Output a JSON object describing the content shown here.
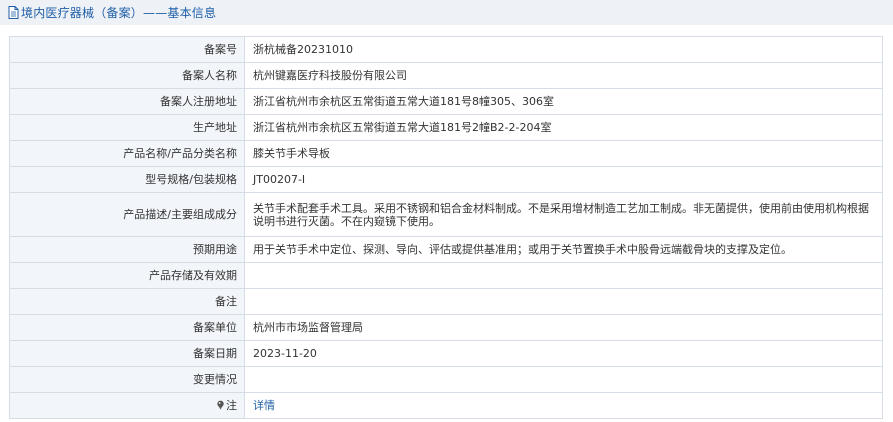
{
  "header": {
    "title": "境内医疗器械（备案）——基本信息",
    "icon": "document-icon"
  },
  "rows": [
    {
      "label": "备案号",
      "value": "浙杭械备20231010"
    },
    {
      "label": "备案人名称",
      "value": "杭州键嘉医疗科技股份有限公司"
    },
    {
      "label": "备案人注册地址",
      "value": "浙江省杭州市余杭区五常街道五常大道181号8幢305、306室"
    },
    {
      "label": "生产地址",
      "value": "浙江省杭州市余杭区五常街道五常大道181号2幢B2-2-204室"
    },
    {
      "label": "产品名称/产品分类名称",
      "value": "膝关节手术导板"
    },
    {
      "label": "型号规格/包装规格",
      "value": "JT00207-I"
    },
    {
      "label": "产品描述/主要组成成分",
      "value": "关节手术配套手术工具。采用不锈钢和铝合金材料制成。不是采用增材制造工艺加工制成。非无菌提供，使用前由使用机构根据说明书进行灭菌。不在内窥镜下使用。"
    },
    {
      "label": "预期用途",
      "value": "用于关节手术中定位、探测、导向、评估或提供基准用；或用于关节置换手术中股骨远端截骨块的支撑及定位。"
    },
    {
      "label": "产品存储及有效期",
      "value": ""
    },
    {
      "label": "备注",
      "value": ""
    },
    {
      "label": "备案单位",
      "value": "杭州市市场监督管理局"
    },
    {
      "label": "备案日期",
      "value": "2023-11-20"
    },
    {
      "label": "变更情况",
      "value": ""
    },
    {
      "label": "注",
      "value": "详情"
    }
  ],
  "colors": {
    "title_bg": "#eef1f6",
    "title_text": "#1f5fa8",
    "label_bg": "#f2f5f9",
    "border": "#d6dde6",
    "link": "#1f5fa8"
  }
}
